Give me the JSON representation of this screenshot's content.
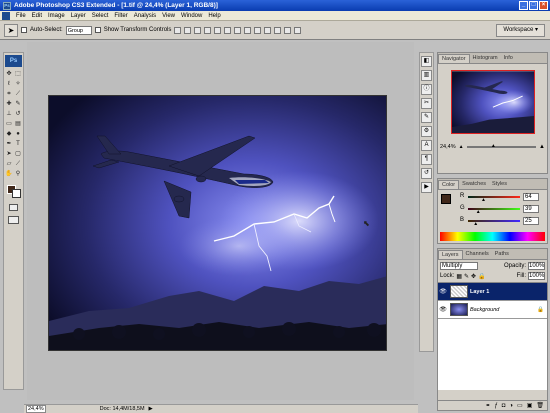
{
  "window": {
    "title": "Adobe Photoshop CS3 Extended - [1.tif @ 24,4% (Layer 1, RGB/8)]",
    "min": "_",
    "max": "□",
    "close": "×"
  },
  "menu": [
    "File",
    "Edit",
    "Image",
    "Layer",
    "Select",
    "Filter",
    "Analysis",
    "View",
    "Window",
    "Help"
  ],
  "options": {
    "auto_select": "Auto-Select:",
    "auto_select_value": "Group",
    "transform": "Show Transform Controls",
    "workspace": "Workspace ▾"
  },
  "tools_logo": "Ps",
  "navigator": {
    "tabs": [
      "Navigator",
      "Histogram",
      "Info"
    ],
    "zoom": "24,4%"
  },
  "color": {
    "tabs": [
      "Color",
      "Swatches",
      "Styles"
    ],
    "r_label": "R",
    "g_label": "G",
    "b_label": "B",
    "r": "64",
    "g": "39",
    "b": "25",
    "r_pos": 0.25,
    "g_pos": 0.15,
    "b_pos": 0.1,
    "fg": "#402719"
  },
  "layers": {
    "tabs": [
      "Layers",
      "Channels",
      "Paths"
    ],
    "blend": "Multiply",
    "opacity_label": "Opacity:",
    "opacity": "100%",
    "lock_label": "Lock:",
    "fill_label": "Fill:",
    "fill": "100%",
    "items": [
      {
        "name": "Layer 1",
        "selected": true
      },
      {
        "name": "Background",
        "selected": false
      }
    ]
  },
  "status": {
    "zoom": "24,4%",
    "doc": "Doc: 14,4M/18,5M"
  }
}
